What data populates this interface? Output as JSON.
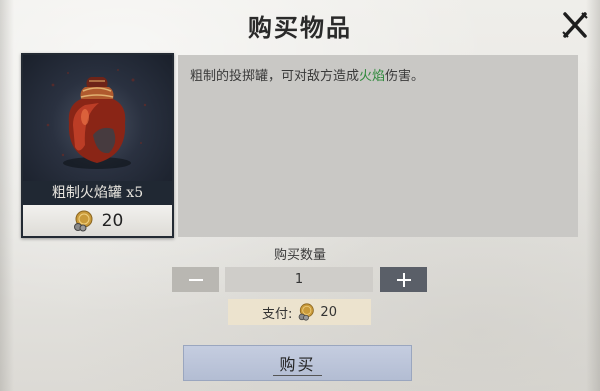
{
  "dialog": {
    "title": "购买物品",
    "close_icon": "close-x-icon"
  },
  "item": {
    "name": "粗制火焰罐 x5",
    "price": "20",
    "price_icon": "gold-coin-icon",
    "image_icon": "fire-pot-icon",
    "description_prefix": "粗制的投掷罐，可对敌方造成",
    "description_highlight": "火焰",
    "description_suffix": "伤害。",
    "highlight_color": "#2f8a3c"
  },
  "quantity": {
    "label": "购买数量",
    "value": "1",
    "decrease_icon": "minus-icon",
    "increase_icon": "plus-icon"
  },
  "payment": {
    "label": "支付:",
    "amount": "20",
    "icon": "gold-coin-icon"
  },
  "buy_button": {
    "label": "购买"
  }
}
